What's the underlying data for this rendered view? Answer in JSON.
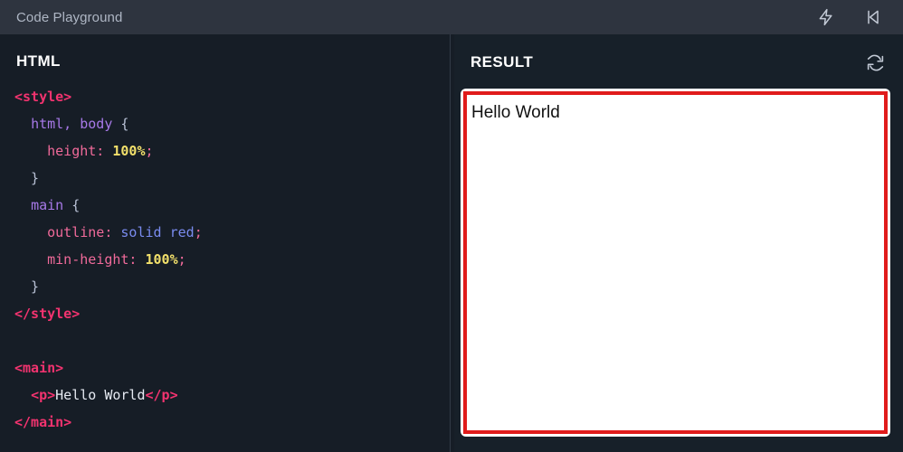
{
  "window": {
    "title": "Code Playground"
  },
  "topbar": {
    "actions": [
      {
        "name": "lightning-icon",
        "label": "Run"
      },
      {
        "name": "skip-back-icon",
        "label": "Collapse panel"
      }
    ]
  },
  "editor": {
    "heading": "HTML",
    "lines": [
      [
        {
          "t": "<style>",
          "c": "tag"
        }
      ],
      [
        {
          "t": "  ",
          "c": "punc"
        },
        {
          "t": "html, body",
          "c": "sel"
        },
        {
          "t": " {",
          "c": "punc"
        }
      ],
      [
        {
          "t": "    ",
          "c": "punc"
        },
        {
          "t": "height:",
          "c": "prop"
        },
        {
          "t": " ",
          "c": "punc"
        },
        {
          "t": "100%",
          "c": "num"
        },
        {
          "t": ";",
          "c": "prop"
        }
      ],
      [
        {
          "t": "  }",
          "c": "punc"
        }
      ],
      [
        {
          "t": "  ",
          "c": "punc"
        },
        {
          "t": "main",
          "c": "sel"
        },
        {
          "t": " {",
          "c": "punc"
        }
      ],
      [
        {
          "t": "    ",
          "c": "punc"
        },
        {
          "t": "outline:",
          "c": "prop"
        },
        {
          "t": " ",
          "c": "punc"
        },
        {
          "t": "solid red",
          "c": "kw"
        },
        {
          "t": ";",
          "c": "prop"
        }
      ],
      [
        {
          "t": "    ",
          "c": "punc"
        },
        {
          "t": "min-height:",
          "c": "prop"
        },
        {
          "t": " ",
          "c": "punc"
        },
        {
          "t": "100%",
          "c": "num"
        },
        {
          "t": ";",
          "c": "prop"
        }
      ],
      [
        {
          "t": "  }",
          "c": "punc"
        }
      ],
      [
        {
          "t": "</style>",
          "c": "tag"
        }
      ],
      [
        {
          "t": "",
          "c": "punc"
        }
      ],
      [
        {
          "t": "<main>",
          "c": "tag"
        }
      ],
      [
        {
          "t": "  ",
          "c": "punc"
        },
        {
          "t": "<p>",
          "c": "tag"
        },
        {
          "t": "Hello World",
          "c": "txt"
        },
        {
          "t": "</p>",
          "c": "tag"
        }
      ],
      [
        {
          "t": "</main>",
          "c": "tag"
        }
      ]
    ]
  },
  "result": {
    "heading": "RESULT",
    "refresh_icon": "refresh-icon",
    "output_text": "Hello World",
    "outline_color": "#e01b1b"
  },
  "colors": {
    "topbar_bg": "#2e343f",
    "editor_bg": "#161d26",
    "result_bg": "#172029",
    "title_text": "#aeb6c4",
    "heading_text": "#ffffff",
    "tag": "#f2336f",
    "selector": "#a779e8",
    "property": "#f06a9a",
    "number": "#f2e06b",
    "keyword": "#7a8cf0",
    "accent_red": "#e01b1b"
  }
}
